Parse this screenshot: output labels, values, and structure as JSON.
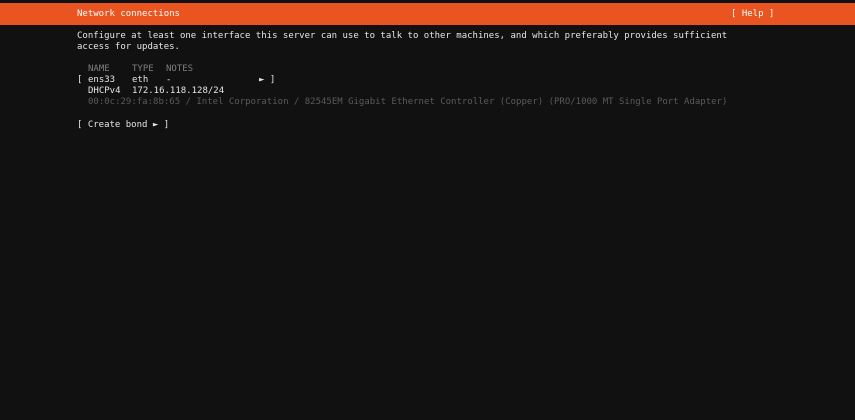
{
  "header": {
    "title": "Network connections",
    "help": "[ Help ]"
  },
  "description": {
    "line1": "Configure at least one interface this server can use to talk to other machines, and which preferably provides sufficient",
    "line2": "access for updates."
  },
  "table": {
    "columns": {
      "name": "NAME",
      "type": "TYPE",
      "notes": "NOTES"
    },
    "interfaces": [
      {
        "open_bracket": "[",
        "name": "ens33",
        "type": "eth",
        "notes": "-",
        "arrow": "► ]",
        "dhcp_label": "DHCPv4",
        "dhcp_address": "172.16.118.128/24",
        "hardware": "00:0c:29:fa:8b:65 / Intel Corporation / 82545EM Gigabit Ethernet Controller (Copper) (PRO/1000 MT Single Port Adapter)"
      }
    ]
  },
  "actions": {
    "create_bond": "[ Create bond ► ]"
  },
  "colors": {
    "header_bg": "#e95420",
    "background": "#111111",
    "text": "#e6e6e6",
    "dim_text": "#7f7f7f"
  }
}
